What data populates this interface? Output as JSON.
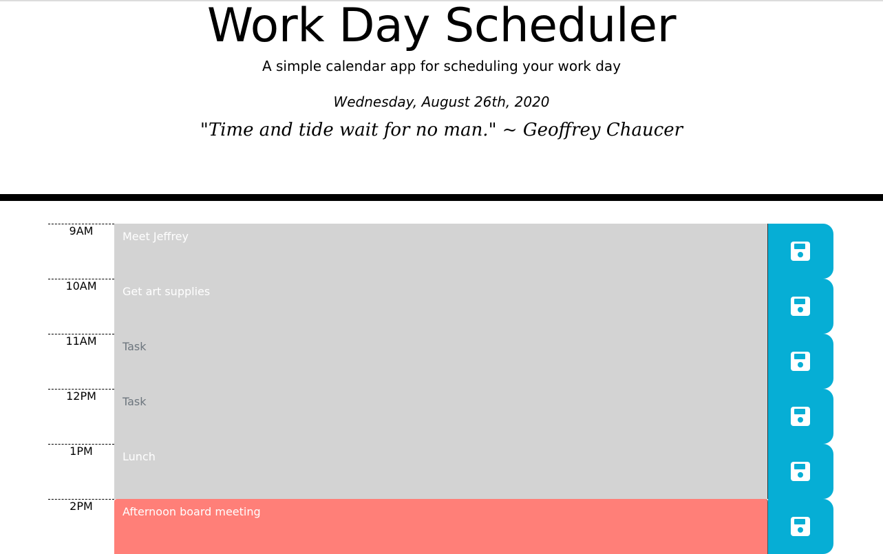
{
  "header": {
    "title": "Work Day Scheduler",
    "lead": "A simple calendar app for scheduling your work day",
    "current_day": "Wednesday, August 26th, 2020",
    "quote": "\"Time and tide wait for no man.\" ~ Geoffrey Chaucer"
  },
  "colors": {
    "past": "#d3d3d3",
    "present": "#ff6961",
    "save_button": "#06aed5"
  },
  "schedule": {
    "rows": [
      {
        "hour": "9AM",
        "text": "Meet Jeffrey",
        "state": "past",
        "icon": "save-icon"
      },
      {
        "hour": "10AM",
        "text": "Get art supplies",
        "state": "past",
        "icon": "save-icon"
      },
      {
        "hour": "11AM",
        "text": "Task",
        "state": "past",
        "placeholder": true,
        "icon": "save-icon"
      },
      {
        "hour": "12PM",
        "text": "Task",
        "state": "past",
        "placeholder": true,
        "icon": "save-icon"
      },
      {
        "hour": "1PM",
        "text": "Lunch",
        "state": "past",
        "icon": "save-icon"
      },
      {
        "hour": "2PM",
        "text": "Afternoon board meeting",
        "state": "present",
        "icon": "save-icon"
      }
    ]
  }
}
